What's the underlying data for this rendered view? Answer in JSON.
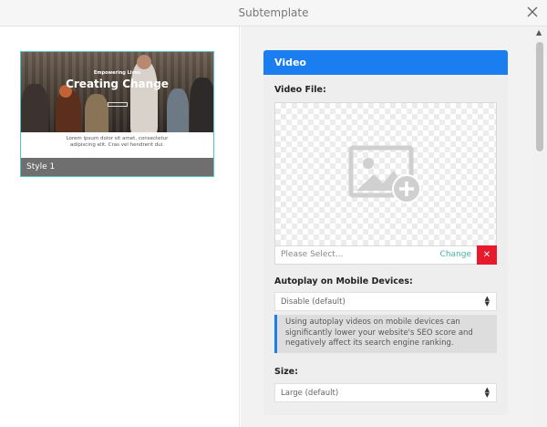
{
  "window": {
    "title": "Subtemplate"
  },
  "style_preview": {
    "subheading": "Empowering Lives",
    "heading": "Creating Change",
    "caption": "Lorem ipsum dolor sit amet, consectetur adipiscing elit. Cras vel hendrerit dui.",
    "label": "Style 1"
  },
  "panel": {
    "title": "Video",
    "video_file": {
      "label": "Video File:",
      "placeholder": "Please Select...",
      "change_label": "Change",
      "clear_label": "✕"
    },
    "autoplay": {
      "label": "Autoplay on Mobile Devices:",
      "value": "Disable (default)",
      "notice": "Using autoplay videos on mobile devices can significantly lower your website's SEO score and negatively affect its search engine ranking."
    },
    "size": {
      "label": "Size:",
      "value": "Large (default)"
    }
  },
  "colors": {
    "accent": "#1a7ef0",
    "change_link": "#45b5a6",
    "clear_button": "#e8192c",
    "selected_border": "#4fc7c5"
  }
}
